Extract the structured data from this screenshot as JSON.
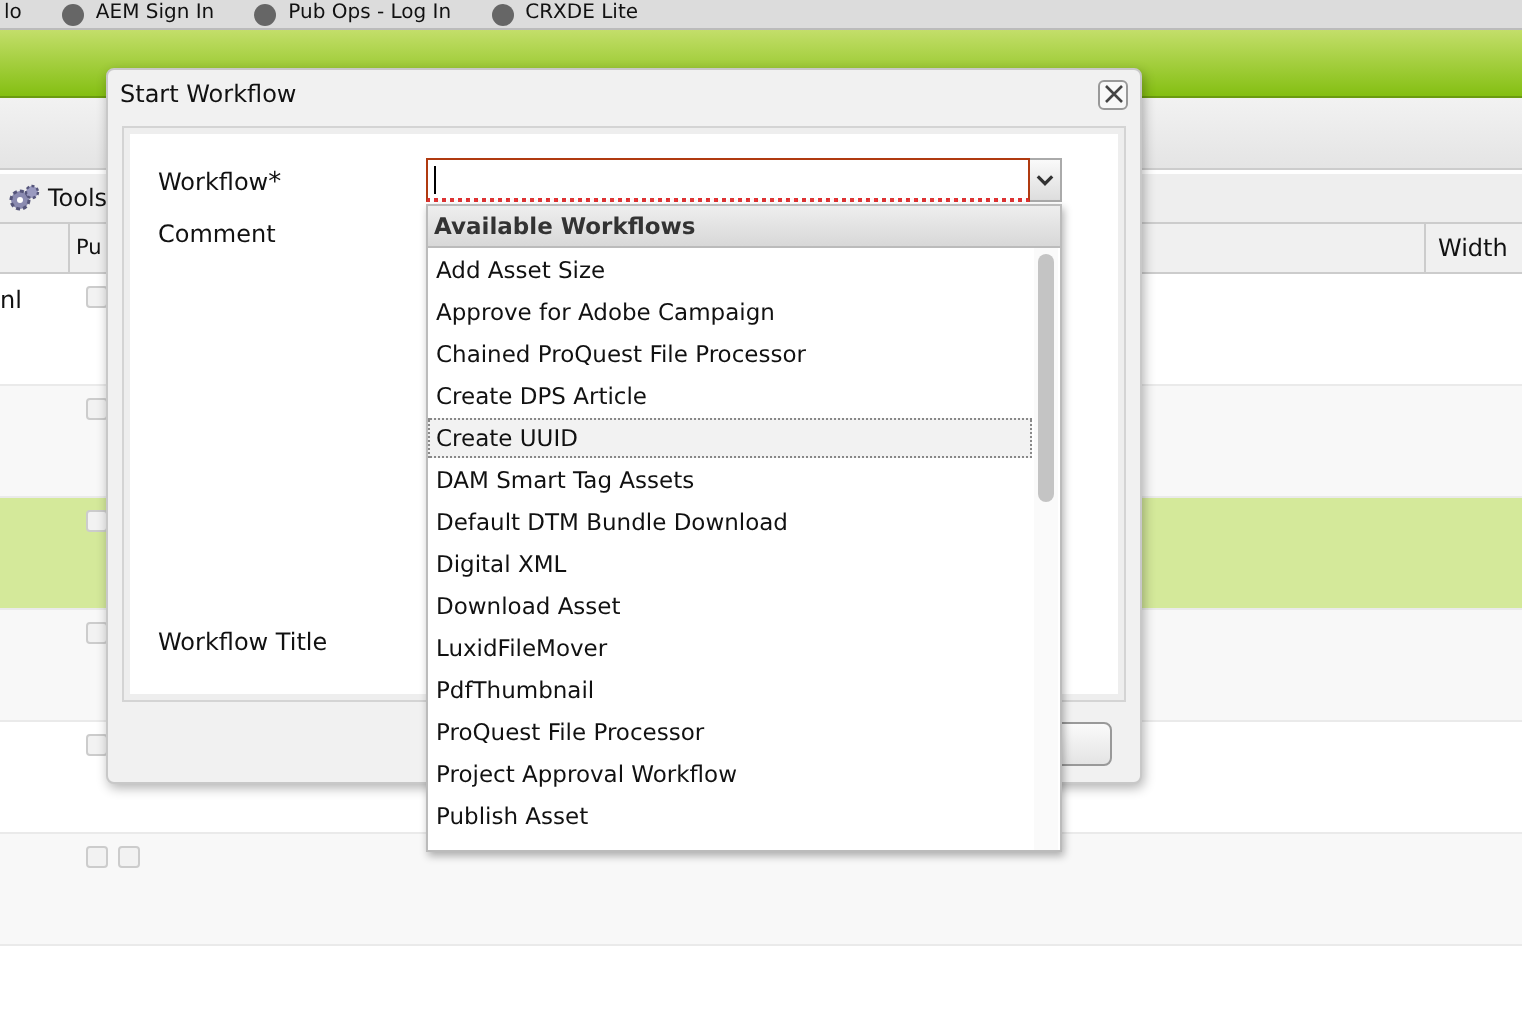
{
  "bookmarks": [
    "lo",
    "AEM Sign In",
    "Pub Ops - Log In",
    "CRXDE Lite"
  ],
  "toolbar": {
    "tools_label": "Tools"
  },
  "table": {
    "columns": [
      "Pu",
      "Width"
    ],
    "rows": [
      {
        "cell": "nl",
        "selected": false,
        "checkboxes": [
          {
            "checked": false
          }
        ]
      },
      {
        "selected": false,
        "checkboxes": [
          {
            "checked": false
          }
        ]
      },
      {
        "selected": true,
        "checkboxes": [
          {
            "checked": false
          }
        ]
      },
      {
        "selected": false,
        "checkboxes": [
          {
            "checked": false
          }
        ]
      },
      {
        "selected": false,
        "checkboxes": [
          {
            "checked": false
          }
        ]
      },
      {
        "selected": false,
        "checkboxes": [
          {
            "checked": false
          },
          {
            "checked": false
          }
        ]
      }
    ]
  },
  "dialog": {
    "title": "Start Workflow",
    "fields": [
      {
        "label": "Workflow",
        "required_mark": "*",
        "invalid": true
      },
      {
        "label": "Comment"
      },
      {
        "label": "Workflow Title"
      }
    ],
    "dropdown": {
      "header": "Available Workflows",
      "items": [
        {
          "label": "Add Asset Size",
          "selected": false
        },
        {
          "label": "Approve for Adobe Campaign",
          "selected": false
        },
        {
          "label": "Chained ProQuest File Processor",
          "selected": false
        },
        {
          "label": "Create DPS Article",
          "selected": false
        },
        {
          "label": "Create UUID",
          "selected": true
        },
        {
          "label": "DAM Smart Tag Assets",
          "selected": false
        },
        {
          "label": "Default DTM Bundle Download",
          "selected": false
        },
        {
          "label": "Digital XML",
          "selected": false
        },
        {
          "label": "Download Asset",
          "selected": false
        },
        {
          "label": "LuxidFileMover",
          "selected": false
        },
        {
          "label": "PdfThumbnail",
          "selected": false
        },
        {
          "label": "ProQuest File Processor",
          "selected": false
        },
        {
          "label": "Project Approval Workflow",
          "selected": false
        },
        {
          "label": "Publish Asset",
          "selected": false
        }
      ]
    }
  }
}
